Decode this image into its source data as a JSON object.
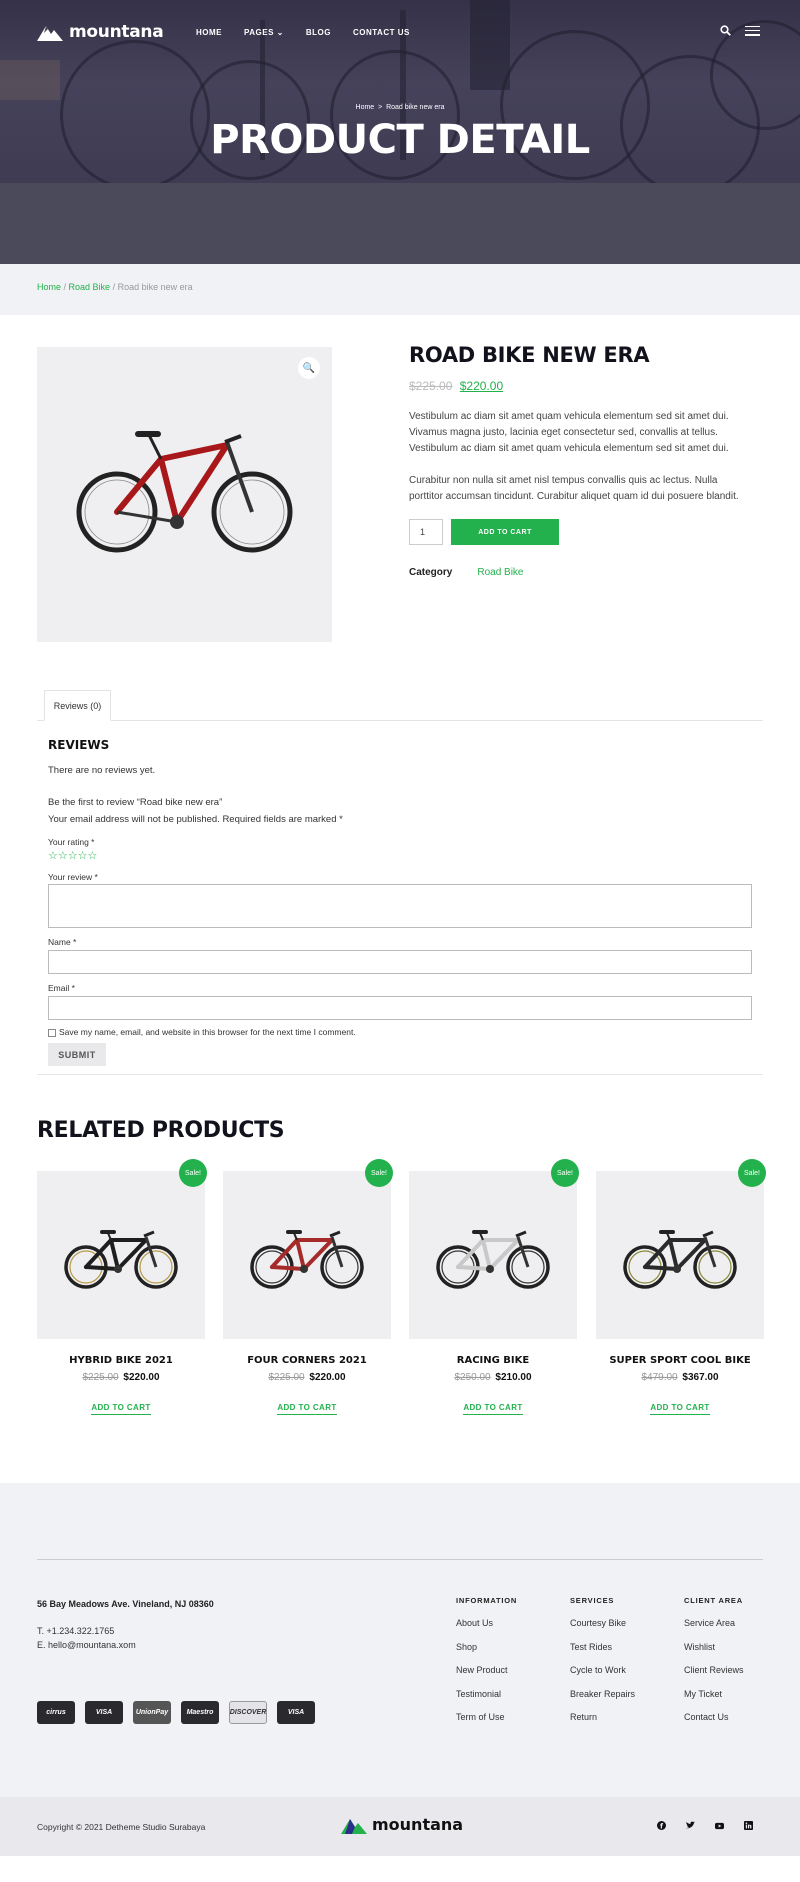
{
  "brand": {
    "name": "mountana"
  },
  "nav": {
    "items": [
      "HOME",
      "PAGES",
      "BLOG",
      "CONTACT US"
    ]
  },
  "hero": {
    "crumb_home": "Home",
    "crumb_sep": ">",
    "crumb_current": "Road bike new era",
    "title": "PRODUCT DETAIL"
  },
  "breadcrumb": {
    "home": "Home",
    "category": "Road Bike",
    "current": "Road bike new era",
    "sep": " / "
  },
  "product": {
    "title": "ROAD BIKE NEW ERA",
    "old_price": "$225.00",
    "price": "$220.00",
    "desc1": "Vestibulum ac diam sit amet quam vehicula elementum sed sit amet dui. Vivamus magna justo, lacinia eget consectetur sed, convallis at tellus. Vestibulum ac diam sit amet quam vehicula elementum sed sit amet dui.",
    "desc2": "Curabitur non nulla sit amet nisl tempus convallis quis ac lectus. Nulla porttitor accumsan tincidunt. Curabitur aliquet quam id dui posuere blandit.",
    "qty": "1",
    "cart_label": "ADD TO CART",
    "category_label": "Category",
    "category_value": "Road Bike"
  },
  "reviews": {
    "tab": "Reviews (0)",
    "heading": "REVIEWS",
    "none": "There are no reviews yet.",
    "first": "Be the first to review “Road bike new era”",
    "note": "Your email address will not be published. Required fields are marked *",
    "rating_label": "Your rating *",
    "stars": "☆☆☆☆☆",
    "review_label": "Your review *",
    "name_label": "Name *",
    "email_label": "Email *",
    "save_label": "Save my name, email, and website in this browser for the next time I comment.",
    "submit": "SUBMIT"
  },
  "related": {
    "title": "RELATED PRODUCTS",
    "sale_badge": "Sale!",
    "cart_label": "ADD TO CART",
    "items": [
      {
        "name": "HYBRID BIKE 2021",
        "old_price": "$225.00",
        "price": "$220.00",
        "frame_color": "#1e1e1e",
        "accent": "#b89b4a"
      },
      {
        "name": "FOUR CORNERS 2021",
        "old_price": "$225.00",
        "price": "$220.00",
        "frame_color": "#a52a2a",
        "accent": "#333333"
      },
      {
        "name": "RACING BIKE",
        "old_price": "$250.00",
        "price": "$210.00",
        "frame_color": "#c8c8c8",
        "accent": "#333333"
      },
      {
        "name": "SUPER SPORT COOL BIKE",
        "old_price": "$479.00",
        "price": "$367.00",
        "frame_color": "#2a2a2a",
        "accent": "#8a8a3a"
      }
    ]
  },
  "footer": {
    "address": "56 Bay Meadows Ave. Vineland, NJ 08360",
    "phone": "T. +1.234.322.1765",
    "email": "E. hello@mountana.xom",
    "payment_cards": [
      "cirrus",
      "VISA",
      "UnionPay",
      "Maestro",
      "DISCOVER",
      "VISA"
    ],
    "cols": [
      {
        "title": "INFORMATION",
        "items": [
          "About Us",
          "Shop",
          "New Product",
          "Testimonial",
          "Term of Use"
        ]
      },
      {
        "title": "SERVICES",
        "items": [
          "Courtesy Bike",
          "Test Rides",
          "Cycle to Work",
          "Breaker Repairs",
          "Return"
        ]
      },
      {
        "title": "CLIENT AREA",
        "items": [
          "Service Area",
          "Wishlist",
          "Client Reviews",
          "My Ticket",
          "Contact Us"
        ]
      }
    ],
    "copyright": "Copyright © 2021 Detheme Studio Surabaya"
  },
  "colors": {
    "accent": "#22b14c",
    "dark": "#12121c",
    "hero": "#4b4a5a"
  }
}
